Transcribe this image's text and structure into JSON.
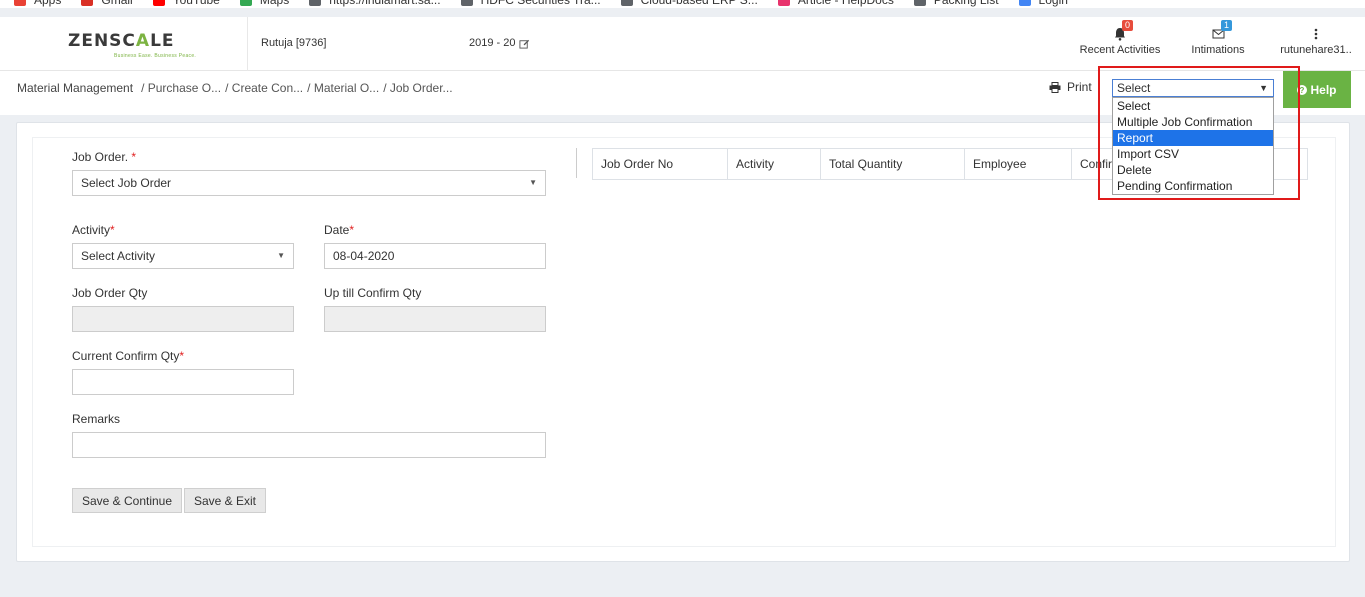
{
  "bookmarks": [
    {
      "label": "Apps",
      "color": "#e94235"
    },
    {
      "label": "Gmail",
      "color": "#d93025"
    },
    {
      "label": "YouTube",
      "color": "#ff0000"
    },
    {
      "label": "Maps",
      "color": "#34a853"
    },
    {
      "label": "https://indiamart.sa...",
      "color": "#5f6368"
    },
    {
      "label": "HDFC Securities Tra...",
      "color": "#5f6368"
    },
    {
      "label": "Cloud-based ERP S...",
      "color": "#5f6368"
    },
    {
      "label": "Article - HelpDocs",
      "color": "#e8336d"
    },
    {
      "label": "Packing List",
      "color": "#5f6368"
    },
    {
      "label": "Login",
      "color": "#4285f4"
    }
  ],
  "header": {
    "logo_text_a": "ZENSC",
    "logo_text_b": "A",
    "logo_text_c": "LE",
    "logo_tagline": "Business Ease. Business Peace.",
    "user": "Rutuja [9736]",
    "year": "2019 - 20",
    "recent_activities_label": "Recent Activities",
    "recent_activities_count": "0",
    "intimations_label": "Intimations",
    "intimations_count": "1",
    "user_menu_label": "rutunehare31.."
  },
  "breadcrumb": {
    "root": "Material Management",
    "items": [
      "/ Purchase O...",
      "/ Create Con...",
      "/ Material O...",
      "/ Job Order..."
    ]
  },
  "toolbar": {
    "print_label": "Print",
    "help_label": "Help",
    "select_value": "Select",
    "select_options": [
      "Select",
      "Multiple Job Confirmation",
      "Report",
      "Import CSV",
      "Delete",
      "Pending Confirmation"
    ],
    "select_active": "Report"
  },
  "form": {
    "job_order_label": "Job Order.",
    "job_order_placeholder": "Select Job Order",
    "activity_label": "Activity",
    "activity_placeholder": "Select Activity",
    "date_label": "Date",
    "date_value": "08-04-2020",
    "job_order_qty_label": "Job Order Qty",
    "up_till_confirm_qty_label": "Up till Confirm Qty",
    "current_confirm_qty_label": "Current Confirm Qty",
    "remarks_label": "Remarks",
    "save_continue_label": "Save & Continue",
    "save_exit_label": "Save & Exit",
    "required_mark": "*"
  },
  "table": {
    "columns": [
      "Job Order No",
      "Activity",
      "Total Quantity",
      "Employee",
      "Confirm"
    ]
  },
  "colors": {
    "accent_green": "#6ab344",
    "highlight_red": "#e01a1a",
    "select_active": "#1e73e8"
  }
}
